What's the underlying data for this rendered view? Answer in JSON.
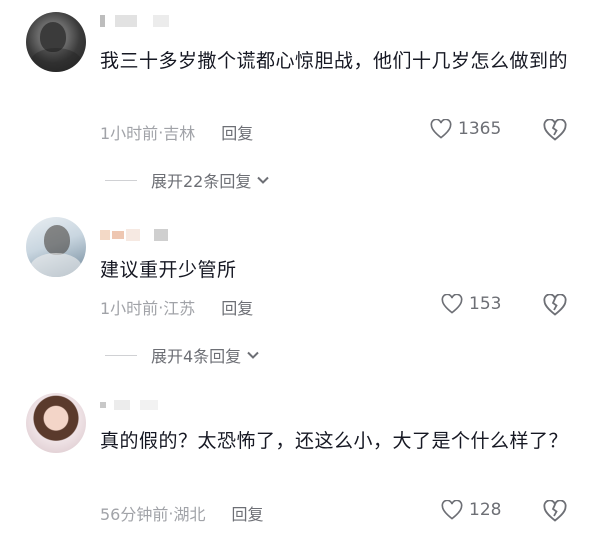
{
  "comments": [
    {
      "text": "我三十多岁撒个谎都心惊胆战，他们十几岁怎么做到的",
      "time": "1小时前",
      "location": "吉林",
      "reply_label": "回复",
      "likes": "1365",
      "expand_label": "展开22条回复"
    },
    {
      "text": "建议重开少管所",
      "time": "1小时前",
      "location": "江苏",
      "reply_label": "回复",
      "likes": "153",
      "expand_label": "展开4条回复"
    },
    {
      "text": "真的假的？太恐怖了，还这么小，大了是个什么样了？",
      "time": "56分钟前",
      "location": "湖北",
      "reply_label": "回复",
      "likes": "128"
    }
  ],
  "separator": " · ",
  "icons": {
    "like": "heart-outline-icon",
    "dislike": "broken-heart-icon",
    "expand": "chevron-down-icon"
  },
  "colors": {
    "text": "#161823",
    "meta": "#a1a3a8",
    "secondary": "#6d6f75"
  }
}
